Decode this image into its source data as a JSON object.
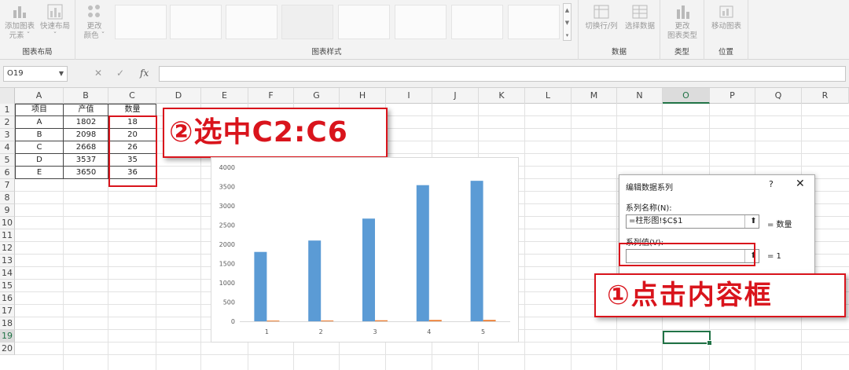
{
  "ribbon": {
    "chart_layouts": {
      "label": "图表布局",
      "add_element": {
        "line1": "添加图表",
        "line2": "元素 ˇ"
      },
      "quick_layout": {
        "line1": "快速布局",
        "line2": "ˇ"
      }
    },
    "chart_styles": {
      "label": "图表样式",
      "change_colors": {
        "line1": "更改",
        "line2": "颜色 ˇ"
      }
    },
    "data": {
      "label": "数据",
      "switch_row_col": "切换行/列",
      "select_data": "选择数据"
    },
    "type": {
      "label": "类型",
      "change_chart_type": {
        "line1": "更改",
        "line2": "图表类型"
      }
    },
    "location": {
      "label": "位置",
      "move_chart": "移动图表"
    }
  },
  "formula_bar": {
    "name_box": "O19",
    "fx": "fx",
    "cancel_glyph": "✕",
    "confirm_glyph": "✓",
    "value": ""
  },
  "columns": [
    "A",
    "B",
    "C",
    "D",
    "E",
    "F",
    "G",
    "H",
    "I",
    "J",
    "K",
    "L",
    "M",
    "N",
    "O",
    "P",
    "Q",
    "R"
  ],
  "rows": [
    "1",
    "2",
    "3",
    "4",
    "5",
    "6",
    "7",
    "8",
    "9",
    "10",
    "11",
    "12",
    "13",
    "14",
    "15",
    "16",
    "17",
    "18",
    "19",
    "20"
  ],
  "selected_column": "O",
  "selected_row": "19",
  "table": {
    "headers": [
      "项目",
      "产值",
      "数量"
    ],
    "rows": [
      [
        "A",
        "1802",
        "18"
      ],
      [
        "B",
        "2098",
        "20"
      ],
      [
        "C",
        "2668",
        "26"
      ],
      [
        "D",
        "3537",
        "35"
      ],
      [
        "E",
        "3650",
        "36"
      ]
    ]
  },
  "annotations": {
    "step2": "②选中C2:C6",
    "step1": "①点击内容框"
  },
  "dialog": {
    "title": "编辑数据系列",
    "help": "?",
    "close": "✕",
    "series_name_label": "系列名称(N):",
    "series_name_value": "=柱形图!$C$1",
    "series_name_result": "= 数量",
    "series_values_label": "系列值(V):",
    "series_values_value": "",
    "series_values_result": "= 1",
    "collapse_glyph": "⬆"
  },
  "colors": {
    "accent_red": "#d9141c",
    "excel_green": "#217346",
    "bar_blue": "#5b9bd5",
    "bar_orange": "#ed7d31"
  },
  "chart_data": {
    "type": "bar",
    "categories": [
      "1",
      "2",
      "3",
      "4",
      "5"
    ],
    "series": [
      {
        "values": [
          1802,
          2098,
          2668,
          3537,
          3650
        ]
      },
      {
        "values": [
          18,
          20,
          26,
          35,
          36
        ]
      }
    ],
    "yticks": [
      "0",
      "500",
      "1000",
      "1500",
      "2000",
      "2500",
      "3000",
      "3500",
      "4000"
    ],
    "ylim": [
      0,
      4000
    ],
    "grid": false,
    "legend": "none"
  }
}
